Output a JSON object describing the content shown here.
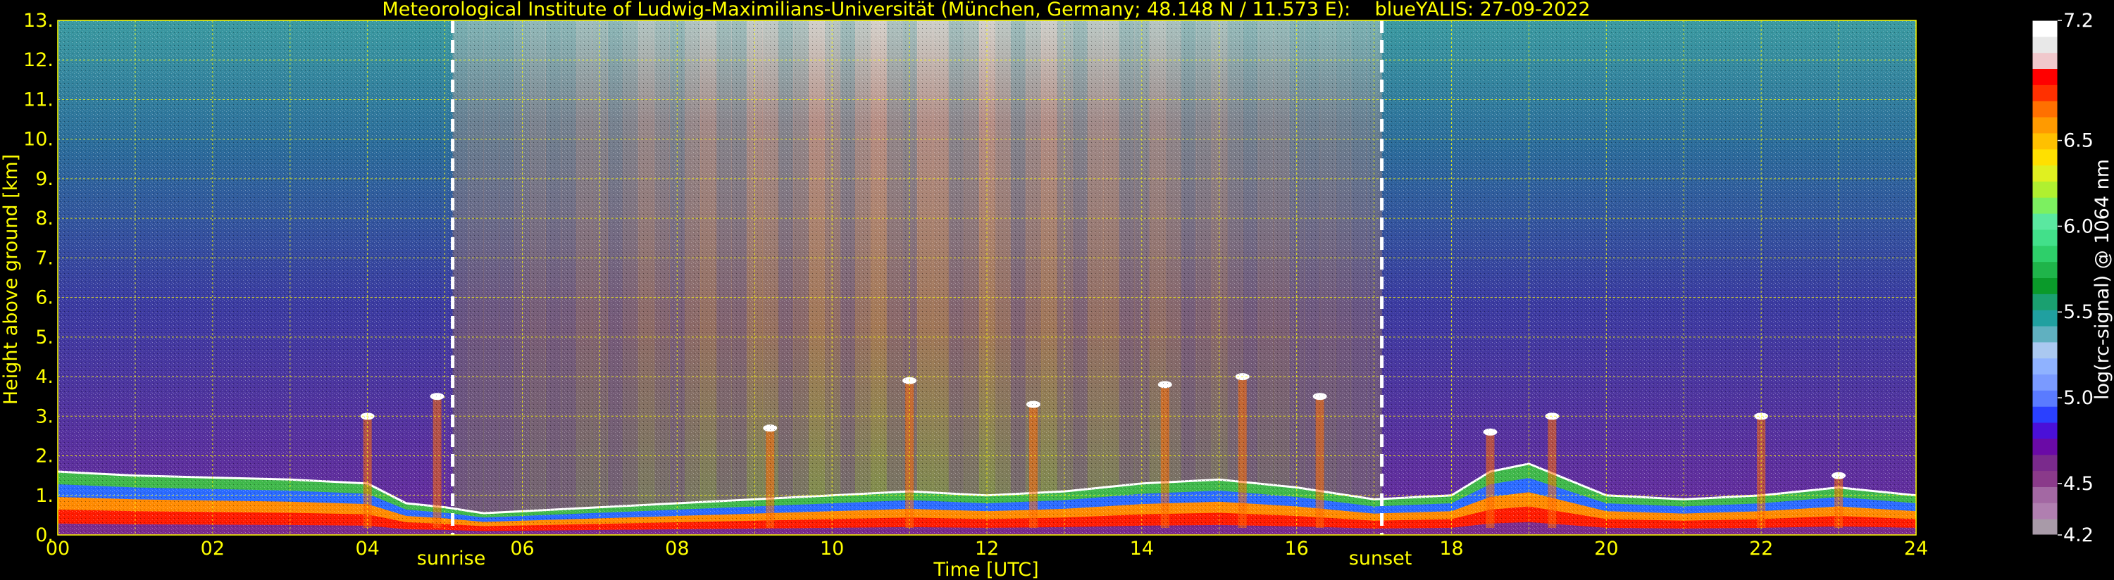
{
  "colors": {
    "background": "#000000",
    "text_accent": "#ffff00",
    "grid": "#ffff00",
    "markers": "#ffffff"
  },
  "chart_data": {
    "type": "heatmap",
    "title": "Meteorological Institute of Ludwig-Maximilians-Universität (München, Germany; 48.148 N / 11.573 E):    blueYALIS: 27-09-2022",
    "xlabel": "Time [UTC]",
    "ylabel": "Height above ground [km]",
    "xlim": [
      0,
      24
    ],
    "ylim": [
      0,
      13
    ],
    "x_ticks": [
      "00",
      "02",
      "04",
      "06",
      "08",
      "10",
      "12",
      "14",
      "16",
      "18",
      "20",
      "22",
      "24"
    ],
    "y_ticks": [
      "0.",
      "1.",
      "2.",
      "3.",
      "4.",
      "5.",
      "6.",
      "7.",
      "8.",
      "9.",
      "10.",
      "11.",
      "12.",
      "13."
    ],
    "grid": true,
    "annotations": [
      {
        "label": "sunrise",
        "x": 5.1
      },
      {
        "label": "sunset",
        "x": 17.1
      }
    ],
    "colorbar": {
      "label": "log(rc-signal) @ 1064 nm",
      "range": [
        4.2,
        7.2
      ],
      "ticks": [
        "7.2",
        "6.5",
        "6.0",
        "5.5",
        "5.0",
        "4.5",
        "4.2"
      ],
      "colors": [
        "#a89aa8",
        "#b07fb0",
        "#a368a3",
        "#8a3a8a",
        "#7a2a8c",
        "#6a0aa6",
        "#4a10d8",
        "#2a40ff",
        "#5a7bff",
        "#7a9aff",
        "#8fb2ff",
        "#aac8f0",
        "#60b0c0",
        "#20a0a0",
        "#1aa070",
        "#0a9a2a",
        "#1fb44a",
        "#2ecf6a",
        "#42e08a",
        "#5ae8a0",
        "#7cf060",
        "#b0f030",
        "#e0f020",
        "#ffe000",
        "#ffc000",
        "#ff9a00",
        "#ff7000",
        "#ff3000",
        "#ff0000",
        "#f0c8cc",
        "#e8e8e8",
        "#ffffff"
      ]
    },
    "series": [
      {
        "name": "boundary_layer_top_km",
        "x": [
          0,
          1,
          2,
          3,
          4,
          4.5,
          5,
          5.5,
          6,
          7,
          8,
          9,
          10,
          11,
          12,
          13,
          14,
          15,
          16,
          17,
          18,
          18.5,
          19,
          20,
          21,
          22,
          23,
          24
        ],
        "values": [
          1.6,
          1.5,
          1.45,
          1.4,
          1.3,
          0.8,
          0.7,
          0.55,
          0.6,
          0.7,
          0.8,
          0.9,
          1.0,
          1.1,
          1.0,
          1.1,
          1.3,
          1.4,
          1.2,
          0.9,
          1.0,
          1.6,
          1.8,
          1.0,
          0.9,
          1.0,
          1.2,
          1.0
        ]
      },
      {
        "name": "cloud_layers_km",
        "x": [
          4.0,
          4.9,
          9.2,
          11.0,
          12.6,
          14.3,
          15.3,
          16.3,
          18.5,
          19.3,
          22.0,
          23.0
        ],
        "values": [
          3.0,
          3.5,
          2.7,
          3.9,
          3.3,
          3.8,
          4.0,
          3.5,
          2.6,
          3.0,
          3.0,
          1.5
        ]
      }
    ]
  }
}
